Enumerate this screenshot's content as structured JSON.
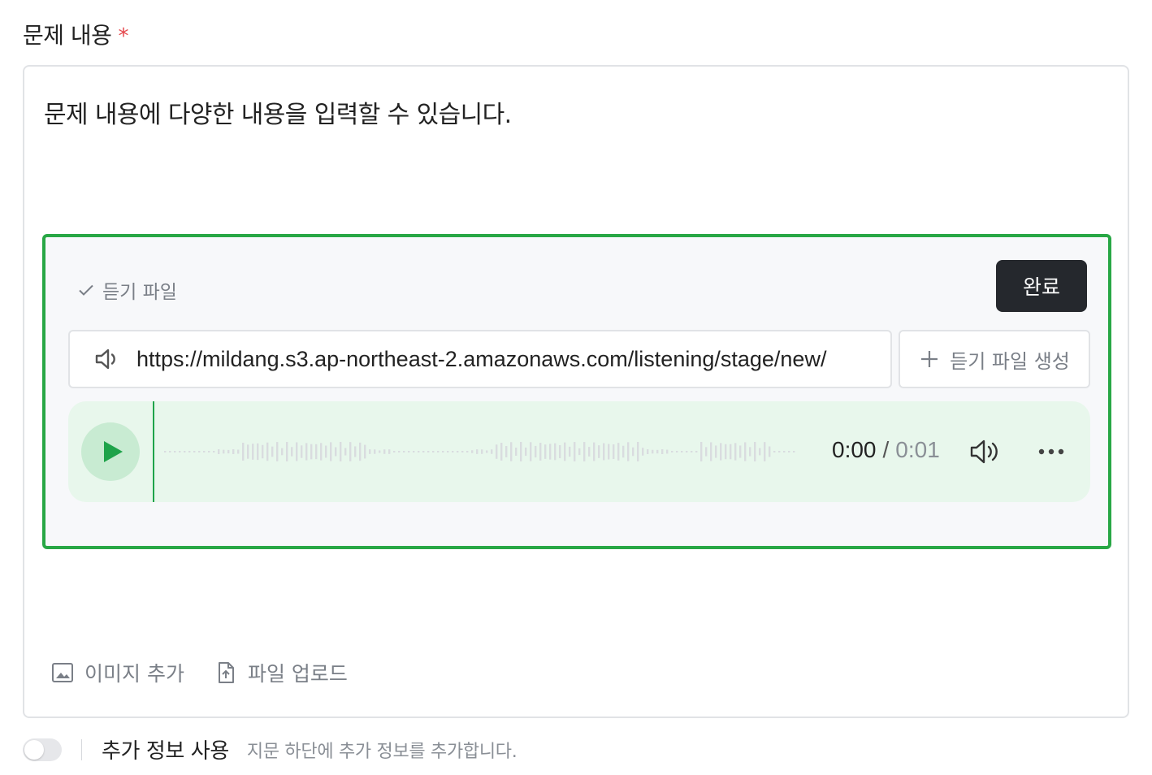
{
  "field": {
    "label": "문제 내용",
    "required_mark": "*"
  },
  "editor": {
    "text": "문제 내용에 다양한 내용을 입력할 수 있습니다."
  },
  "audio_block": {
    "title": "듣기 파일",
    "done_label": "완료",
    "url": "https://mildang.s3.ap-northeast-2.amazonaws.com/listening/stage/new/",
    "generate_label": "듣기 파일 생성",
    "player": {
      "current_time": "0:00",
      "separator": "/",
      "duration": "0:01"
    },
    "accent_color": "#28a745"
  },
  "toolbar": {
    "add_image": "이미지 추가",
    "upload_file": "파일 업로드"
  },
  "extra_info": {
    "title": "추가 정보 사용",
    "description": "지문 하단에 추가 정보를 추가합니다.",
    "enabled": false
  },
  "icons": [
    "check-icon",
    "speaker-icon",
    "plus-icon",
    "play-icon",
    "volume-icon",
    "more-icon",
    "image-icon",
    "file-upload-icon"
  ]
}
